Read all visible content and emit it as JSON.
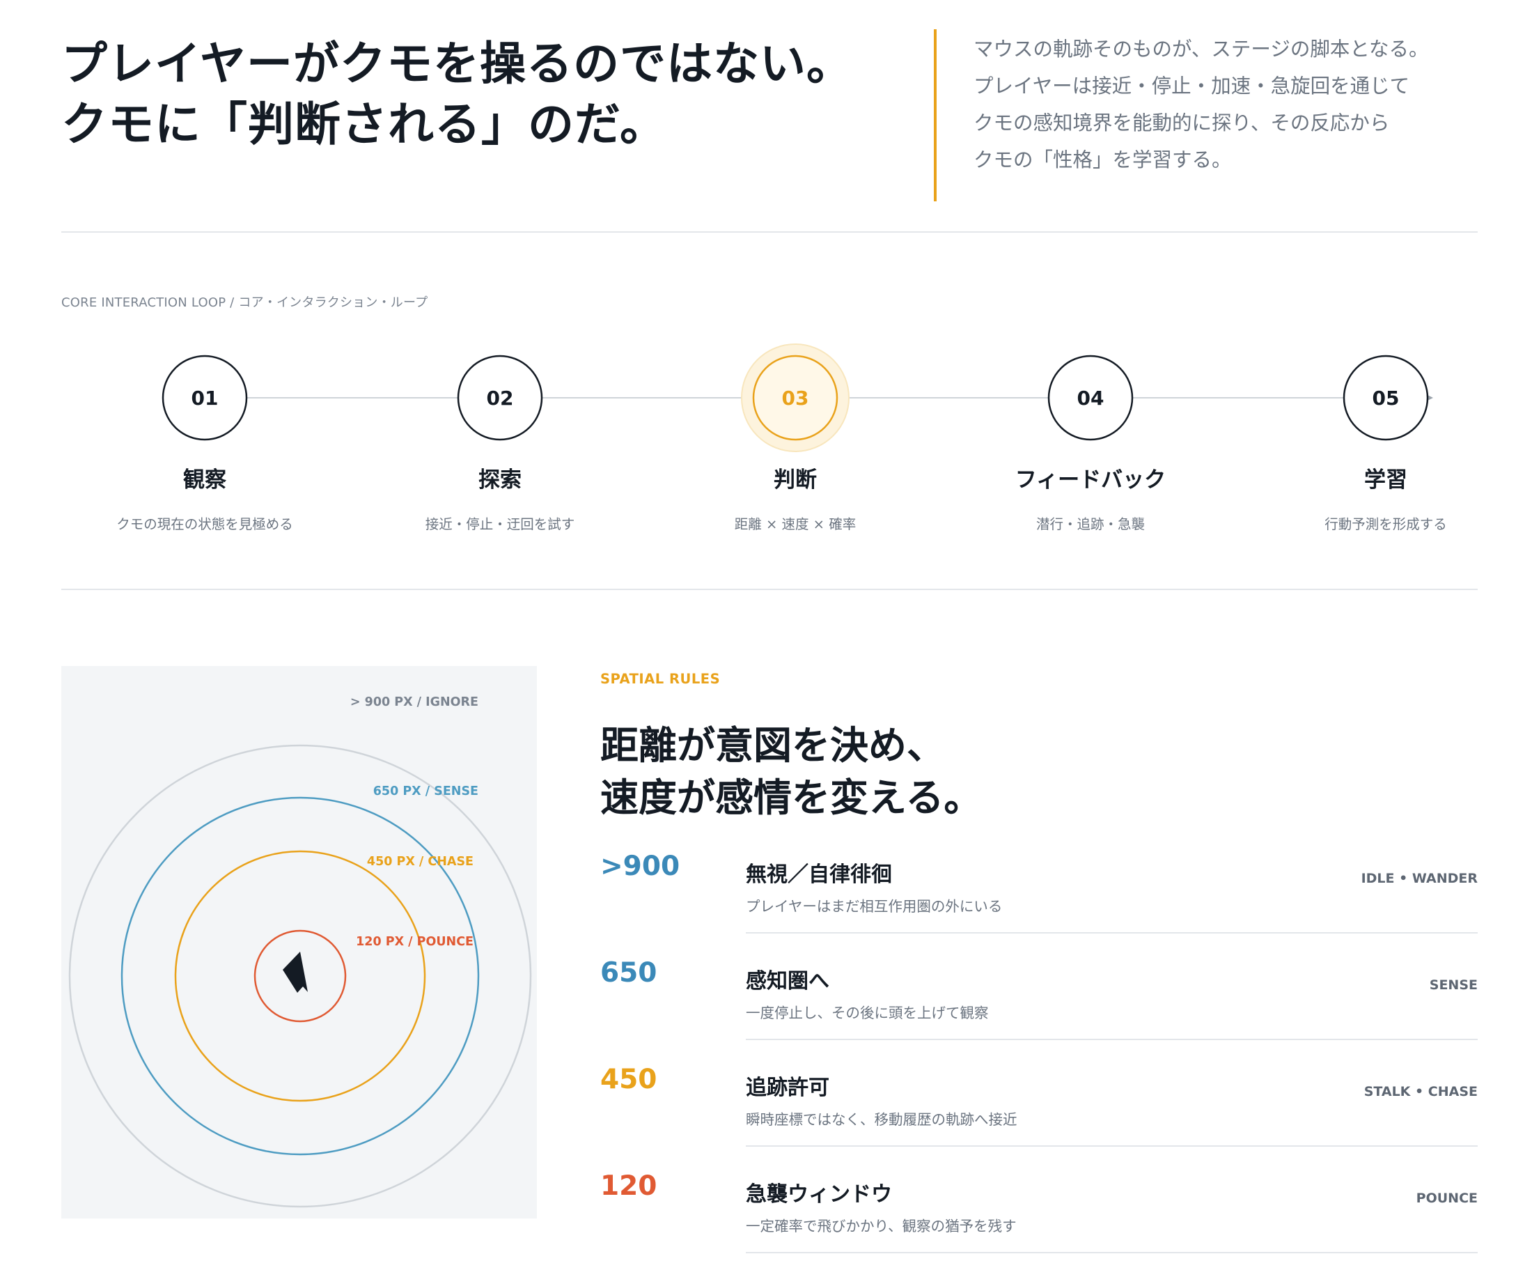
{
  "hero": {
    "title_lines": [
      "プレイヤーがクモを操るのではない。",
      "クモに「判断される」のだ。"
    ],
    "lead_lines": [
      "マウスの軌跡そのものが、ステージの脚本となる。",
      "プレイヤーは接近・停止・加速・急旋回を通じて",
      "クモの感知境界を能動的に探り、その反応から",
      "クモの「性格」を学習する。"
    ]
  },
  "loop": {
    "eyebrow": "CORE INTERACTION LOOP  /  コア・インタラクション・ループ",
    "active_index": 2,
    "steps": [
      {
        "number": "01",
        "label": "観察",
        "desc": "クモの現在の状態を見極める"
      },
      {
        "number": "02",
        "label": "探索",
        "desc": "接近・停止・迂回を試す"
      },
      {
        "number": "03",
        "label": "判断",
        "desc": "距離 × 速度 × 確率"
      },
      {
        "number": "04",
        "label": "フィードバック",
        "desc": "潜行・追跡・急襲"
      },
      {
        "number": "05",
        "label": "学習",
        "desc": "行動予測を形成する"
      }
    ]
  },
  "radar": {
    "outer_label": "> 900 PX / IGNORE",
    "zones": [
      {
        "name": "sense",
        "radius_px_value": 650,
        "label": "650 PX / SENSE",
        "color": "#4e9cc2"
      },
      {
        "name": "chase",
        "radius_px_value": 450,
        "label": "450 PX / CHASE",
        "color": "#e9a21b"
      },
      {
        "name": "pounce",
        "radius_px_value": 120,
        "label": "120 PX / POUNCE",
        "color": "#e05a33"
      }
    ],
    "outer_ring_color": "#cfd4d9",
    "cursor_icon": "cursor-arrow-icon"
  },
  "rules": {
    "eyebrow": "SPATIAL RULES",
    "title_lines": [
      "距離が意図を決め、",
      "速度が感情を変える。"
    ],
    "items": [
      {
        "value": ">900",
        "title": "無視／自律徘徊",
        "desc": "プレイヤーはまだ相互作用圏の外にいる",
        "tag": "IDLE • WANDER",
        "color": "#3b89b8"
      },
      {
        "value": "650",
        "title": "感知圏へ",
        "desc": "一度停止し、その後に頭を上げて観察",
        "tag": "SENSE",
        "color": "#3b89b8"
      },
      {
        "value": "450",
        "title": "追跡許可",
        "desc": "瞬時座標ではなく、移動履歴の軌跡へ接近",
        "tag": "STALK • CHASE",
        "color": "#e9a21b"
      },
      {
        "value": "120",
        "title": "急襲ウィンドウ",
        "desc": "一定確率で飛びかかり、観察の猶予を残す",
        "tag": "POUNCE",
        "color": "#e05a33"
      }
    ]
  },
  "colors": {
    "accent": "#e9a21b",
    "ink": "#141b24",
    "muted": "#6b7480",
    "divider": "#e3e6ea"
  }
}
